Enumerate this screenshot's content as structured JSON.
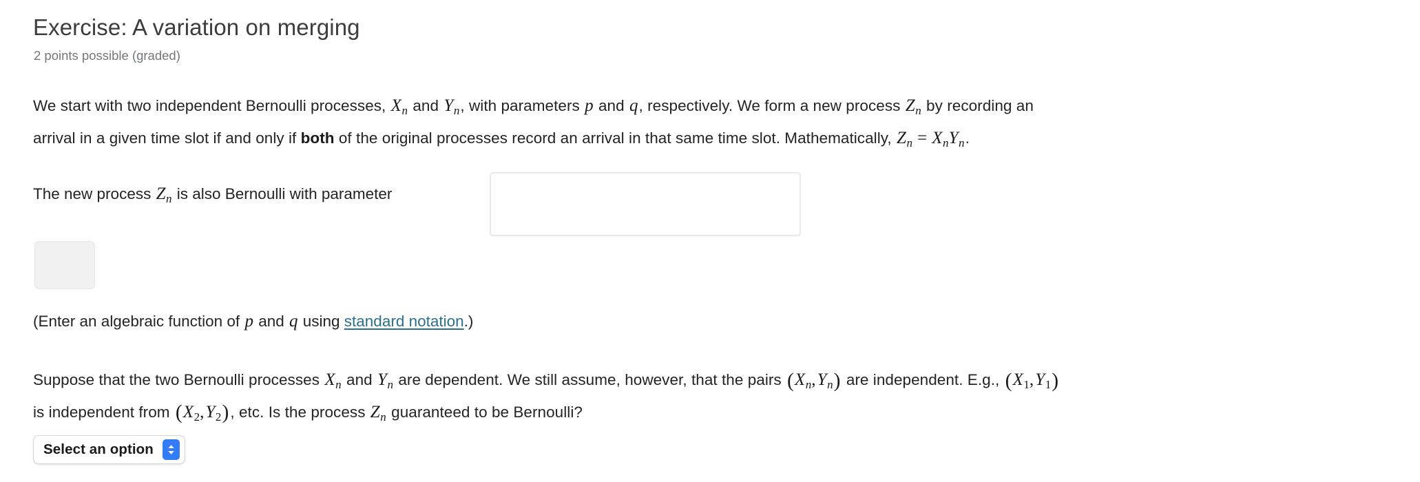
{
  "exercise": {
    "title": "Exercise: A variation on merging",
    "points": "2 points possible (graded)"
  },
  "intro": {
    "line1": {
      "t1": "We start with two independent Bernoulli processes, ",
      "m1": "X",
      "m1sub": "n",
      "t2": " and ",
      "m2": "Y",
      "m2sub": "n",
      "t3": ", with parameters ",
      "m3": "p",
      "t4": " and ",
      "m4": "q",
      "t5": ", respectively. We form a new process ",
      "m5": "Z",
      "m5sub": "n",
      "t6": " by recording an"
    },
    "line2": {
      "t1": "arrival in a given time slot if and only if ",
      "bold": "both",
      "t2": " of the original processes record an arrival in that same time slot. Mathematically, ",
      "m1": "Z",
      "m1sub": "n",
      "eq": "=",
      "m2": "X",
      "m2sub": "n",
      "m3": "Y",
      "m3sub": "n",
      "t3": "."
    }
  },
  "answer": {
    "prompt_t1": "The new process ",
    "prompt_m": "Z",
    "prompt_msub": "n",
    "prompt_t2": " is also Bernoulli with parameter",
    "input_value": "",
    "input_placeholder": ""
  },
  "hint": {
    "t1": "(Enter an algebraic function of ",
    "m1": "p",
    "t2": " and ",
    "m2": "q",
    "t3": " using ",
    "link": "standard notation",
    "t4": ".)"
  },
  "dependent": {
    "line1": {
      "t1": "Suppose that the two Bernoulli processes ",
      "m1": "X",
      "m1sub": "n",
      "t2": " and ",
      "m2": "Y",
      "m2sub": "n",
      "t3": " are dependent. We still assume, however, that the pairs ",
      "p1o": "(",
      "p1a": "X",
      "p1asub": "n",
      "p1comma": ",",
      "p1b": "Y",
      "p1bsub": "n",
      "p1c": ")",
      "t4": " are independent. E.g., ",
      "p2o": "(",
      "p2a": "X",
      "p2asub": "1",
      "p2comma": ",",
      "p2b": "Y",
      "p2bsub": "1",
      "p2c": ")"
    },
    "line2": {
      "t1": "is independent from ",
      "p3o": "(",
      "p3a": "X",
      "p3asub": "2",
      "p3comma": ",",
      "p3b": "Y",
      "p3bsub": "2",
      "p3c": ")",
      "t2": ", etc. Is the process ",
      "m1": "Z",
      "m1sub": "n",
      "t3": " guaranteed to be Bernoulli?"
    }
  },
  "select": {
    "selected_label": "Select an option",
    "icon": "chevron-up-down-icon",
    "accent_color": "#347bf6"
  },
  "colors": {
    "text": "#242424",
    "muted": "#74777a",
    "link": "#2c6f8c",
    "input_border": "#e9eaec",
    "preview_box": "#f1f1f1"
  }
}
